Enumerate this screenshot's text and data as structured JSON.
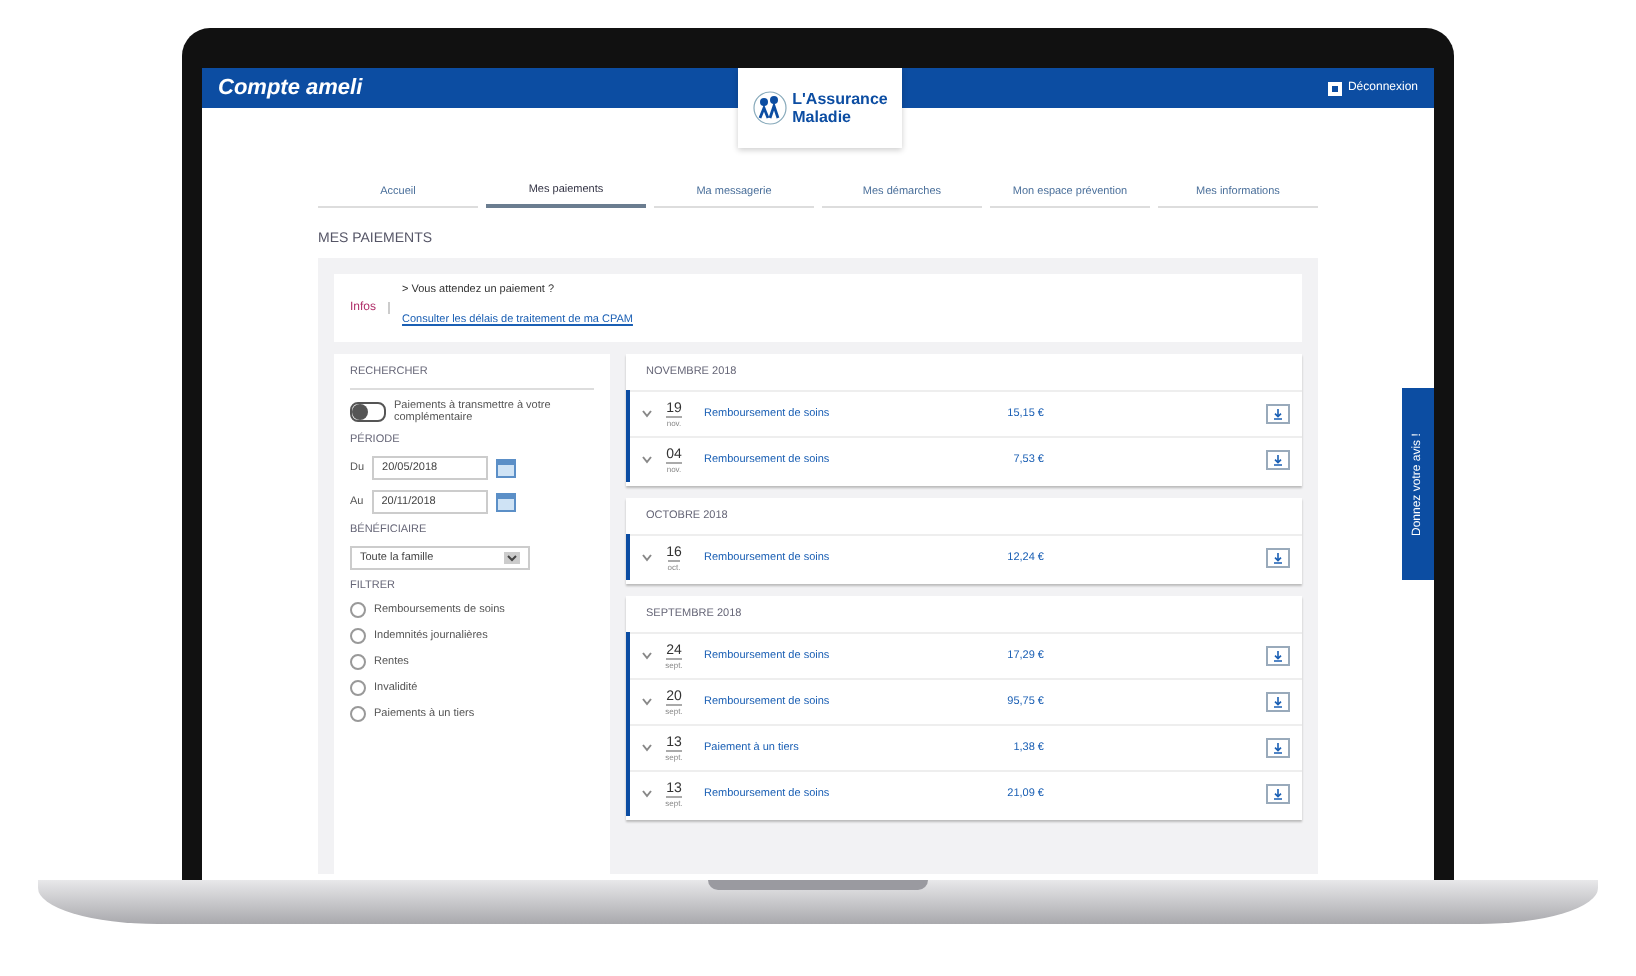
{
  "header": {
    "title": "Compte ameli",
    "logo": [
      "L'Assurance",
      "Maladie"
    ],
    "logout": "Déconnexion"
  },
  "tabs": [
    {
      "label": "Accueil",
      "selected": false
    },
    {
      "label": "Mes paiements",
      "selected": true
    },
    {
      "label": "Ma messagerie",
      "selected": false
    },
    {
      "label": "Mes démarches",
      "selected": false
    },
    {
      "label": "Mon espace prévention",
      "selected": false
    },
    {
      "label": "Mes informations",
      "selected": false
    }
  ],
  "page_title": "MES PAIEMENTS",
  "info": {
    "label": "Infos",
    "text": "> Vous attendez un paiement ?",
    "link": "Consulter les délais de traitement de ma CPAM"
  },
  "search": {
    "title": "RECHERCHER",
    "toggle": {
      "label": "Paiements à transmettre à votre complémentaire",
      "on": false
    },
    "period_title": "PÉRIODE",
    "from": {
      "label": "Du",
      "value": "20/05/2018"
    },
    "to": {
      "label": "Au",
      "value": "20/11/2018"
    },
    "beneficiary_title": "BÉNÉFICIAIRE",
    "beneficiary": "Toute la famille",
    "filter_title": "FILTRER",
    "filters": [
      {
        "label": "Remboursements de soins",
        "checked": false
      },
      {
        "label": "Indemnités journalières",
        "checked": false
      },
      {
        "label": "Rentes",
        "checked": false
      },
      {
        "label": "Invalidité",
        "checked": false
      },
      {
        "label": "Paiements à un tiers",
        "checked": false
      }
    ]
  },
  "payments": [
    {
      "month": "NOVEMBRE 2018",
      "items": [
        {
          "day": "19",
          "month": "nov.",
          "label": "Remboursement de soins",
          "amount": "15,15 €"
        },
        {
          "day": "04",
          "month": "nov.",
          "label": "Remboursement de soins",
          "amount": "7,53 €"
        }
      ]
    },
    {
      "month": "OCTOBRE 2018",
      "items": [
        {
          "day": "16",
          "month": "oct.",
          "label": "Remboursement de soins",
          "amount": "12,24 €"
        }
      ]
    },
    {
      "month": "SEPTEMBRE 2018",
      "items": [
        {
          "day": "24",
          "month": "sept.",
          "label": "Remboursement de soins",
          "amount": "17,29 €"
        },
        {
          "day": "20",
          "month": "sept.",
          "label": "Remboursement de soins",
          "amount": "95,75 €"
        },
        {
          "day": "13",
          "month": "sept.",
          "label": "Paiement à un tiers",
          "amount": "1,38 €"
        },
        {
          "day": "13",
          "month": "sept.",
          "label": "Remboursement de soins",
          "amount": "21,09 €"
        }
      ]
    }
  ],
  "feedback": "Donnez votre avis !"
}
